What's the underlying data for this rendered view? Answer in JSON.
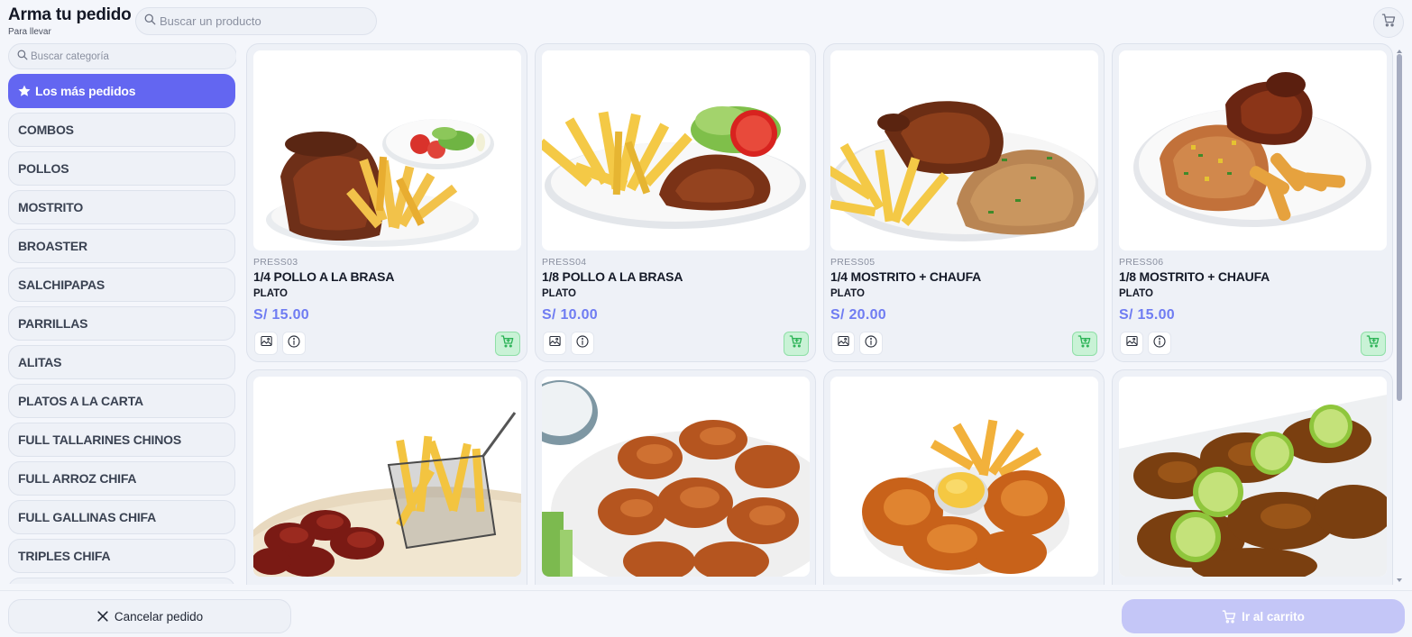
{
  "header": {
    "title": "Arma tu pedido",
    "subtitle": "Para llevar",
    "search_placeholder": "Buscar un producto",
    "cart_icon": "cart-icon"
  },
  "sidebar": {
    "search_placeholder": "Buscar categoría",
    "active_category": "Los más pedidos",
    "categories": [
      "COMBOS",
      "POLLOS",
      "MOSTRITO",
      "BROASTER",
      "SALCHIPAPAS",
      "PARRILLAS",
      "ALITAS",
      "PLATOS A LA CARTA",
      "FULL TALLARINES CHINOS",
      "FULL ARROZ CHIFA",
      "FULL GALLINAS CHIFA",
      "TRIPLES CHIFA"
    ]
  },
  "products": [
    {
      "code": "PRESS03",
      "name": "1/4 POLLO A LA BRASA",
      "type": "PLATO",
      "price": "S/ 15.00"
    },
    {
      "code": "PRESS04",
      "name": "1/8 POLLO A LA BRASA",
      "type": "PLATO",
      "price": "S/ 10.00"
    },
    {
      "code": "PRESS05",
      "name": "1/4 MOSTRITO + CHAUFA",
      "type": "PLATO",
      "price": "S/ 20.00"
    },
    {
      "code": "PRESS06",
      "name": "1/8 MOSTRITO + CHAUFA",
      "type": "PLATO",
      "price": "S/ 15.00"
    }
  ],
  "card_icons": {
    "image": "image-icon",
    "info": "info-icon",
    "add": "cart-add-icon"
  },
  "footer": {
    "cancel_label": "Cancelar pedido",
    "go_cart_label": "Ir al carrito"
  },
  "colors": {
    "accent": "#6366f1",
    "price": "#6f7cf2",
    "add_button": "#c9f2d6",
    "go_cart_disabled": "#c4c6f7",
    "background": "#f4f6fb"
  }
}
